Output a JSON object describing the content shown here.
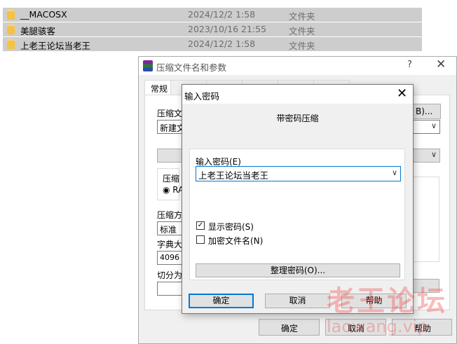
{
  "explorer": {
    "files": [
      {
        "name": "__MACOSX",
        "date": "2024/12/2 1:58",
        "type": "文件夹"
      },
      {
        "name": "美腿骇客",
        "date": "2023/10/16 21:55",
        "type": "文件夹"
      },
      {
        "name": "上老王论坛当老王",
        "date": "2024/12/2 1:58",
        "type": "文件夹"
      }
    ]
  },
  "archive_dialog": {
    "title": "压缩文件名和参数",
    "help_glyph": "?",
    "close_glyph": "✕",
    "tabs": [
      "常规"
    ],
    "fragments": {
      "archive_name_label": "压缩文",
      "archive_name_value": "新建文",
      "browse_suffix": "B)...",
      "format_label": "压缩",
      "format_rar": "RA",
      "method_label": "压缩方",
      "method_value": "标准",
      "dict_label": "字典大",
      "dict_value": "4096",
      "split_label": "切分为"
    },
    "buttons": {
      "ok": "确定",
      "cancel": "取消",
      "help": "帮助"
    }
  },
  "password_dialog": {
    "title": "输入密码",
    "close_glyph": "✕",
    "heading": "带密码压缩",
    "password_label": "输入密码(E)",
    "password_value": "上老王论坛当老王",
    "show_password": {
      "label": "显示密码(S)",
      "checked": true
    },
    "encrypt_names": {
      "label": "加密文件名(N)",
      "checked": false
    },
    "organize_button": "整理密码(O)...",
    "buttons": {
      "ok": "确定",
      "cancel": "取消",
      "help": "帮助"
    }
  },
  "watermark": {
    "cn": "老王论坛",
    "en": "laowang.vip"
  }
}
